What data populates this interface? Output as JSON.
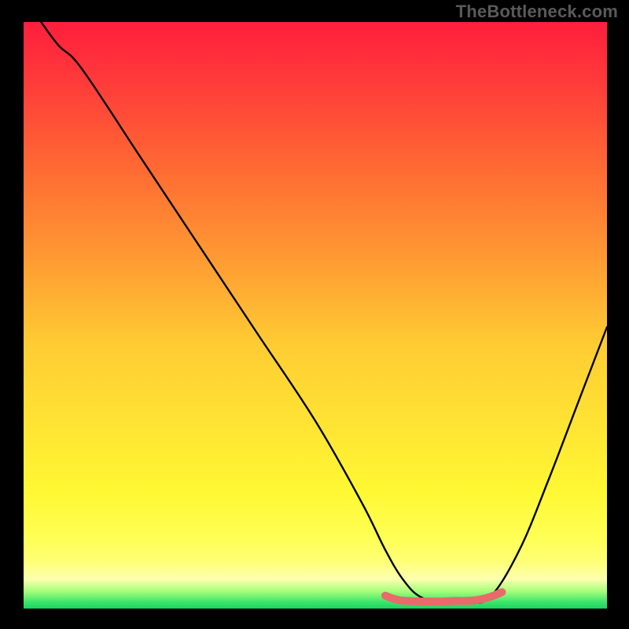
{
  "watermark": "TheBottleneck.com",
  "chart_data": {
    "type": "line",
    "title": "",
    "xlabel": "",
    "ylabel": "",
    "xlim": [
      0,
      100
    ],
    "ylim": [
      0,
      100
    ],
    "gradient_colors": {
      "top": "#ff1e3c",
      "mid": "#ffe633",
      "bottom": "#1dd35e"
    },
    "series": [
      {
        "name": "main-curve",
        "color": "#000000",
        "x": [
          3,
          6,
          10,
          20,
          30,
          40,
          50,
          58,
          62,
          65,
          68,
          72,
          76,
          80,
          85,
          90,
          95,
          100
        ],
        "y": [
          100,
          96,
          92,
          77,
          62,
          47,
          32,
          18,
          10,
          5,
          2,
          1,
          1,
          2,
          10,
          22,
          35,
          48
        ]
      },
      {
        "name": "bottom-highlight",
        "color": "#e86a6a",
        "x": [
          62,
          64,
          66,
          68,
          70,
          72,
          74,
          76,
          78,
          80,
          82
        ],
        "y": [
          2.2,
          1.5,
          1.3,
          1.2,
          1.2,
          1.2,
          1.3,
          1.3,
          1.5,
          2.0,
          2.8
        ]
      }
    ]
  }
}
